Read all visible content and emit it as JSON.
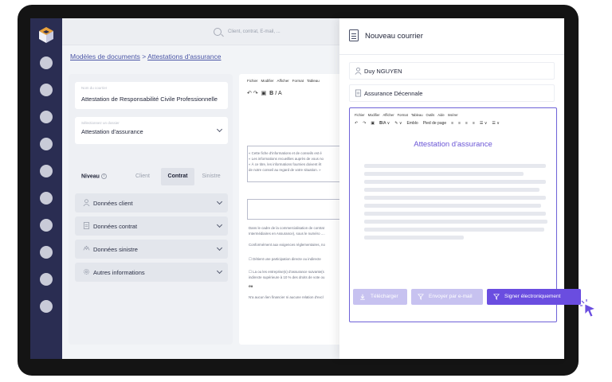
{
  "search": {
    "placeholder": "Client, contrat, E-mail, ..."
  },
  "breadcrumb": {
    "root": "Modèles de documents",
    "separator": " > ",
    "current": "Attestations d'assurance"
  },
  "form": {
    "fields": [
      {
        "label": "Nom du courrier",
        "value": "Attestation de Responsabilité Civile Professionnelle",
        "has_dropdown": false
      },
      {
        "label": "Sélectionnez un dossier",
        "value": "Attestation d'assurance",
        "has_dropdown": true
      }
    ],
    "niveau": {
      "label": "Niveau",
      "options": [
        "Client",
        "Contrat",
        "Sinistre"
      ],
      "selected": "Contrat"
    },
    "sections": [
      {
        "label": "Données client",
        "icon": "user-icon"
      },
      {
        "label": "Données contrat",
        "icon": "document-icon"
      },
      {
        "label": "Données sinistre",
        "icon": "hands-icon"
      },
      {
        "label": "Autres informations",
        "icon": "gear-icon"
      }
    ]
  },
  "doc_editor": {
    "menu": [
      "Fichier",
      "Modifier",
      "Afficher",
      "Format",
      "Tableau"
    ],
    "box_lines": [
      "« Cette fiche d'informations et de conseils est é",
      "« Les informations recueillies auprès de vous no",
      "« À ce titre, les informations fournies doivent êt",
      "de notre conseil au regard de votre situation. »"
    ],
    "paragraphs": [
      "Dans le cadre de la commercialisation de contrat",
      "Intermédiaires en Assurance), sous le numéro ....",
      "Conformément aux exigences réglementaires, no",
      "☐ Détient une participation directe ou indirecte",
      "☐ La ou les entreprise(s) d'assurance suivante(s",
      "indirecte supérieure à 10 % des droits de vote ou",
      "ou",
      "N'a aucun lien financier ni aucune relation d'excl"
    ]
  },
  "modal": {
    "title": "Nouveau courrier",
    "recipient": "Duy NGUYEN",
    "document": "Assurance Décennale",
    "editor": {
      "menu": [
        "Fichier",
        "Modifier",
        "Afficher",
        "Format",
        "Tableau",
        "Outils",
        "Aide",
        "Insérer"
      ],
      "toolbar": [
        "↶",
        "↷",
        "▣",
        "B",
        "I",
        "A ∨",
        "✎ ∨",
        "Emblo",
        "Pied de page",
        "≡",
        "≡",
        "≡",
        "≡",
        "☰ ∨",
        "☰ ∨"
      ],
      "heading": "Attestation d'assurance"
    },
    "buttons": {
      "download": "Télécharger",
      "email": "Envoyer par e-mail",
      "sign": "Signer électroniquement"
    }
  },
  "colors": {
    "accent": "#6a4de0",
    "sidebar": "#2a2d52",
    "link": "#4b56a6"
  }
}
